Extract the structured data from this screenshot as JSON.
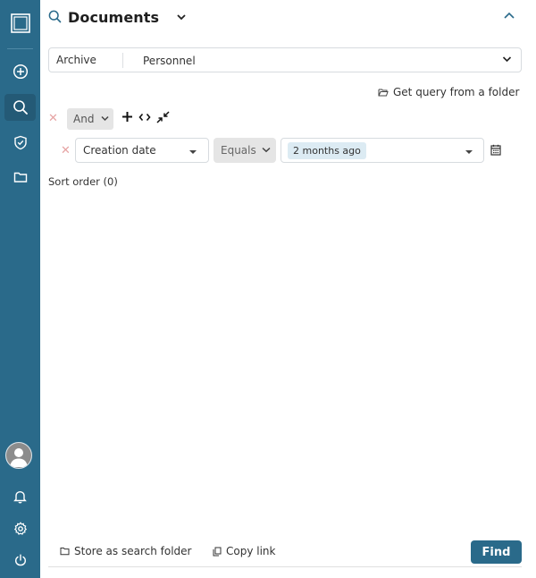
{
  "header": {
    "title": "Documents"
  },
  "archive": {
    "label": "Archive",
    "value": "Personnel"
  },
  "query_folder_label": "Get query from a folder",
  "operator": {
    "value": "And"
  },
  "condition": {
    "field": "Creation date",
    "comparator": "Equals",
    "value": "2 months ago"
  },
  "sort_order": "Sort order (0)",
  "footer": {
    "store_label": "Store as search folder",
    "copy_label": "Copy link",
    "find_label": "Find"
  },
  "icons": {
    "sidebar": [
      "app-logo-icon",
      "plus-circle-icon",
      "search-icon",
      "shield-check-icon",
      "folder-icon",
      "user-avatar-icon",
      "bell-icon",
      "gear-icon",
      "power-icon"
    ]
  },
  "colors": {
    "sidebar": "#2a6a8a",
    "sidebar_active": "#245a76",
    "primary_button": "#2a6a8a",
    "tag_background": "#dcebf3",
    "remove_x": "#e6a3a3"
  }
}
